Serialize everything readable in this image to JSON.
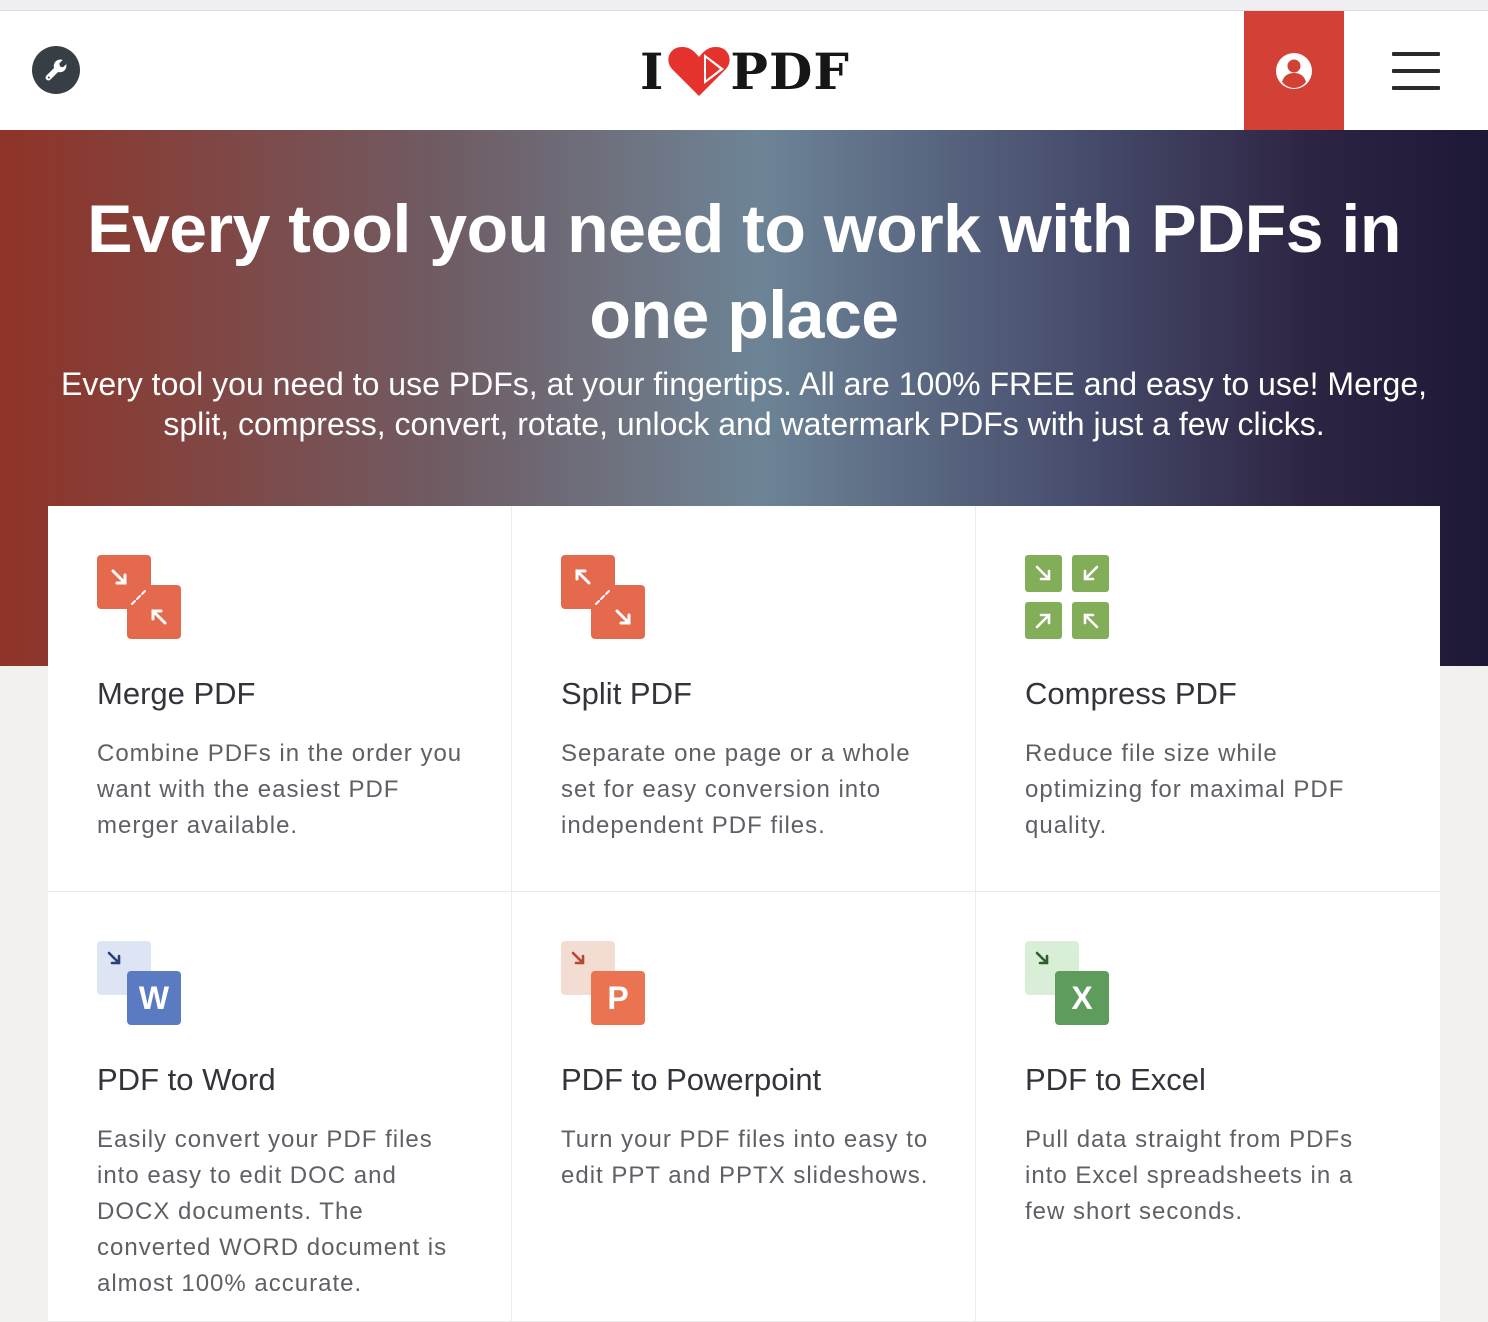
{
  "header": {
    "logo_left": "I",
    "logo_right": "PDF",
    "tools_icon": "wrench-icon",
    "account_icon": "user-circle-icon",
    "menu_icon": "hamburger-menu-icon"
  },
  "hero": {
    "title": "Every tool you need to work with PDFs in one place",
    "subtitle": "Every tool you need to use PDFs, at your fingertips. All are 100% FREE and easy to use! Merge, split, compress, convert, rotate, unlock and watermark PDFs with just a few clicks."
  },
  "tools": [
    {
      "title": "Merge PDF",
      "description": "Combine PDFs in the order you want with the easiest PDF merger available.",
      "icon": "merge-icon",
      "color": "#e5694d"
    },
    {
      "title": "Split PDF",
      "description": "Separate one page or a whole set for easy conversion into independent PDF files.",
      "icon": "split-icon",
      "color": "#e5694d"
    },
    {
      "title": "Compress PDF",
      "description": "Reduce file size while optimizing for maximal PDF quality.",
      "icon": "compress-icon",
      "color": "#82ad59"
    },
    {
      "title": "PDF to Word",
      "description": "Easily convert your PDF files into easy to edit DOC and DOCX documents. The converted WORD document is almost 100% accurate.",
      "icon": "word-icon",
      "icon_letter": "W",
      "color": "#5a7bc2"
    },
    {
      "title": "PDF to Powerpoint",
      "description": "Turn your PDF files into easy to edit PPT and PPTX slideshows.",
      "icon": "powerpoint-icon",
      "icon_letter": "P",
      "color": "#ea7352"
    },
    {
      "title": "PDF to Excel",
      "description": "Pull data straight from PDFs into Excel spreadsheets in a few short seconds.",
      "icon": "excel-icon",
      "icon_letter": "X",
      "color": "#5e9c5e"
    }
  ],
  "colors": {
    "accent_red": "#d34136",
    "hero_gradient": [
      "#8f3327",
      "#6d8496",
      "#1e1837"
    ]
  }
}
